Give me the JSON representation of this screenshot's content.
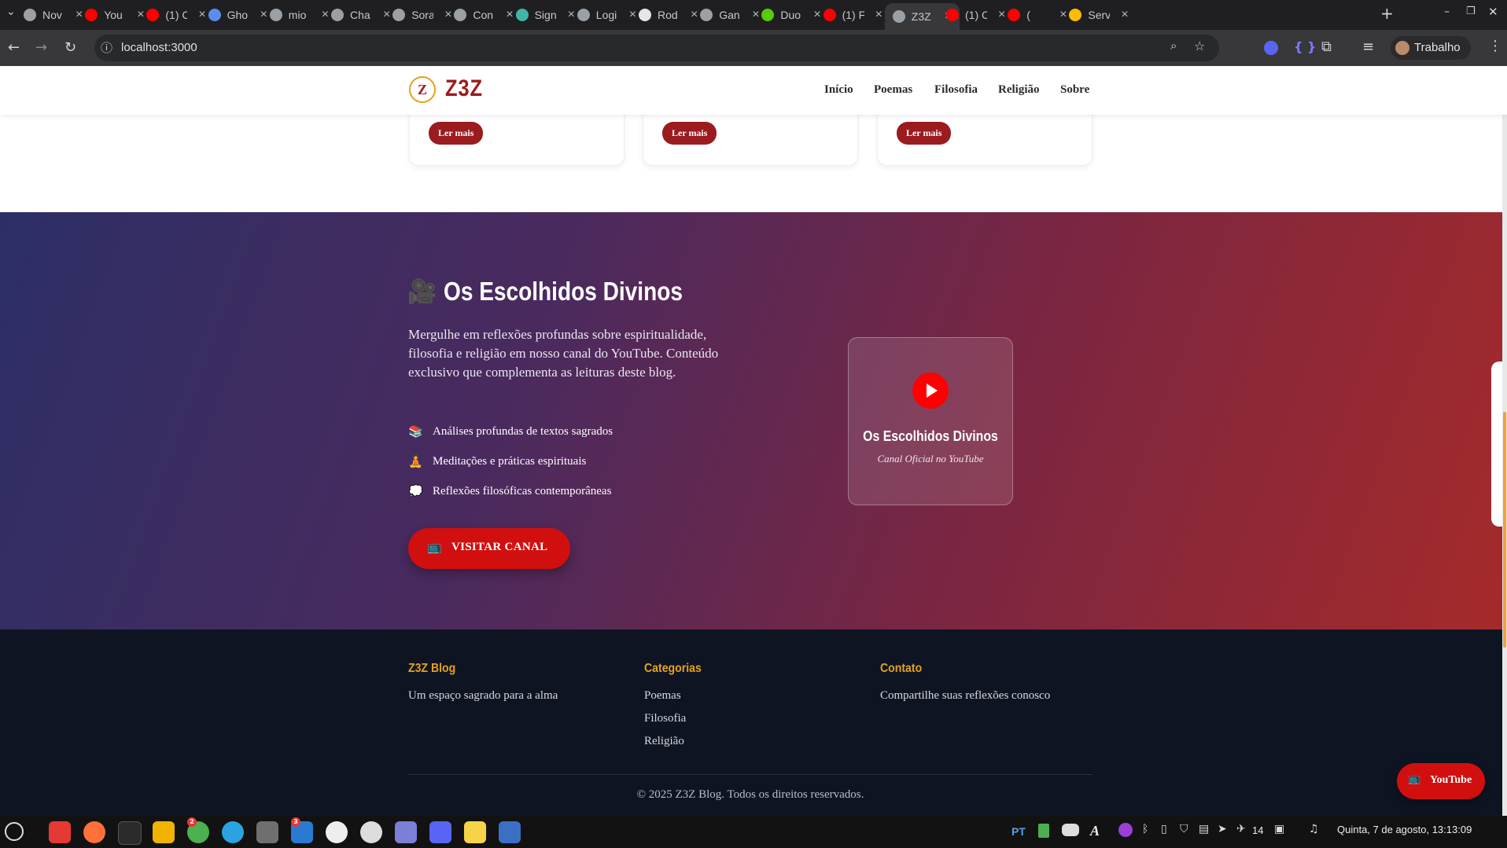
{
  "browser": {
    "tabs": [
      {
        "label": "Nov",
        "color": "#9aa0a6"
      },
      {
        "label": "You",
        "color": "#ff0000"
      },
      {
        "label": "(1) C",
        "color": "#ff0000"
      },
      {
        "label": "Gho",
        "color": "#5b8def"
      },
      {
        "label": "mio",
        "color": "#9aa0a6"
      },
      {
        "label": "Cha",
        "color": "#9aa0a6"
      },
      {
        "label": "Sora",
        "color": "#9aa0a6"
      },
      {
        "label": "Con",
        "color": "#9aa0a6"
      },
      {
        "label": "Sign",
        "color": "#3fb5a5"
      },
      {
        "label": "Logi",
        "color": "#9aa0a6"
      },
      {
        "label": "Rod",
        "color": "#e6e6e6"
      },
      {
        "label": "Gan",
        "color": "#9aa0a6"
      },
      {
        "label": "Duo",
        "color": "#58cc02"
      },
      {
        "label": "(1) F",
        "color": "#ff0000"
      },
      {
        "label": "Z3Z",
        "color": "#9aa0a6"
      },
      {
        "label": "(1) C",
        "color": "#ff0000"
      },
      {
        "label": "(",
        "color": "#ff0000"
      },
      {
        "label": "Serv",
        "color": "#fbbc04"
      }
    ],
    "url": "localhost:3000",
    "profile": "Trabalho"
  },
  "site": {
    "logo_text": "Z3Z",
    "logo_letter": "Z",
    "nav": [
      "Início",
      "Poemas",
      "Filosofia",
      "Religião",
      "Sobre"
    ],
    "cards": [
      {
        "button": "Ler mais"
      },
      {
        "button": "Ler mais"
      },
      {
        "button": "Ler mais"
      }
    ],
    "hero": {
      "emoji": "🎥",
      "title": "Os Escolhidos Divinos",
      "description": "Mergulhe em reflexões profundas sobre espiritualidade, filosofia e religião em nosso canal do YouTube. Conteúdo exclusivo que complementa as leituras deste blog.",
      "features": [
        {
          "icon": "📚",
          "text": "Análises profundas de textos sagrados"
        },
        {
          "icon": "🧘",
          "text": "Meditações e práticas espirituais"
        },
        {
          "icon": "💭",
          "text": "Reflexões filosóficas contemporâneas"
        }
      ],
      "cta_icon": "📺",
      "cta_label": "VISITAR CANAL",
      "channel_card": {
        "title": "Os Escolhidos Divinos",
        "subtitle": "Canal Oficial no YouTube"
      }
    },
    "footer": {
      "col1": {
        "heading": "Z3Z Blog",
        "text": "Um espaço sagrado para a alma"
      },
      "col2": {
        "heading": "Categorias",
        "links": [
          "Poemas",
          "Filosofia",
          "Religião"
        ]
      },
      "col3": {
        "heading": "Contato",
        "text": "Compartilhe suas reflexões conosco"
      },
      "copyright": "© 2025 Z3Z Blog. Todos os direitos reservados."
    },
    "floating_button": {
      "icon": "📺",
      "label": "YouTube"
    }
  },
  "taskbar": {
    "lang": "PT",
    "badge_chrome": "2",
    "badge_vscode": "3",
    "tray_count": "14",
    "clock": "Quinta, 7 de agosto, 13:13:09"
  },
  "colors": {
    "accent": "#9b1b1f",
    "gold": "#e3a21a",
    "youtube": "#ff0000"
  }
}
